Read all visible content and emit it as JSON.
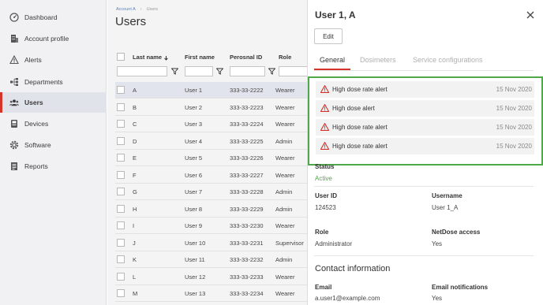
{
  "sidebar": {
    "items": [
      {
        "label": "Dashboard",
        "icon": "dashboard-icon"
      },
      {
        "label": "Account profile",
        "icon": "building-icon"
      },
      {
        "label": "Alerts",
        "icon": "warning-icon"
      },
      {
        "label": "Departments",
        "icon": "hierarchy-icon"
      },
      {
        "label": "Users",
        "icon": "users-icon",
        "active": true
      },
      {
        "label": "Devices",
        "icon": "device-icon"
      },
      {
        "label": "Software",
        "icon": "gear-icon"
      },
      {
        "label": "Reports",
        "icon": "report-icon"
      }
    ]
  },
  "main": {
    "breadcrumb": [
      "Account A",
      "Users"
    ],
    "title": "Users"
  },
  "table": {
    "headers": {
      "last_name": "Last name",
      "first_name": "First name",
      "personal_id": "Perosnal ID",
      "role": "Role"
    },
    "rows": [
      {
        "last": "A",
        "first": "User 1",
        "id": "333-33-2222",
        "role": "Wearer"
      },
      {
        "last": "B",
        "first": "User 2",
        "id": "333-33-2223",
        "role": "Wearer"
      },
      {
        "last": "C",
        "first": "User 3",
        "id": "333-33-2224",
        "role": "Wearer"
      },
      {
        "last": "D",
        "first": "User 4",
        "id": "333-33-2225",
        "role": "Admin"
      },
      {
        "last": "E",
        "first": "User 5",
        "id": "333-33-2226",
        "role": "Wearer"
      },
      {
        "last": "F",
        "first": "User 6",
        "id": "333-33-2227",
        "role": "Wearer"
      },
      {
        "last": "G",
        "first": "User 7",
        "id": "333-33-2228",
        "role": "Admin"
      },
      {
        "last": "H",
        "first": "User 8",
        "id": "333-33-2229",
        "role": "Admin"
      },
      {
        "last": "I",
        "first": "User 9",
        "id": "333-33-2230",
        "role": "Wearer"
      },
      {
        "last": "J",
        "first": "User 10",
        "id": "333-33-2231",
        "role": "Supervisor"
      },
      {
        "last": "K",
        "first": "User 11",
        "id": "333-33-2232",
        "role": "Admin"
      },
      {
        "last": "L",
        "first": "User 12",
        "id": "333-33-2233",
        "role": "Wearer"
      },
      {
        "last": "M",
        "first": "User 13",
        "id": "333-33-2234",
        "role": "Wearer"
      }
    ]
  },
  "panel": {
    "title": "User 1, A",
    "edit_label": "Edit",
    "tabs": [
      "General",
      "Dosimeters",
      "Service configurations"
    ],
    "alerts": [
      {
        "text": "High dose rate alert",
        "date": "15 Nov 2020"
      },
      {
        "text": "High dose alert",
        "date": "15 Nov 2020"
      },
      {
        "text": "High dose rate alert",
        "date": "15 Nov 2020"
      },
      {
        "text": "High dose rate alert",
        "date": "15 Nov 2020"
      }
    ],
    "status_label": "Status",
    "status_value": "Active",
    "user_id_label": "User ID",
    "user_id_value": "124523",
    "username_label": "Username",
    "username_value": "User 1_A",
    "role_label": "Role",
    "role_value": "Administrator",
    "netdose_label": "NetDose access",
    "netdose_value": "Yes",
    "contact_title": "Contact information",
    "email_label": "Email",
    "email_value": "a.user1@example.com",
    "email_notif_label": "Email notifications",
    "email_notif_value": "Yes"
  },
  "colors": {
    "accent": "#d4342a",
    "highlight_box": "#4fa84a",
    "status_active": "#4fa84a"
  }
}
